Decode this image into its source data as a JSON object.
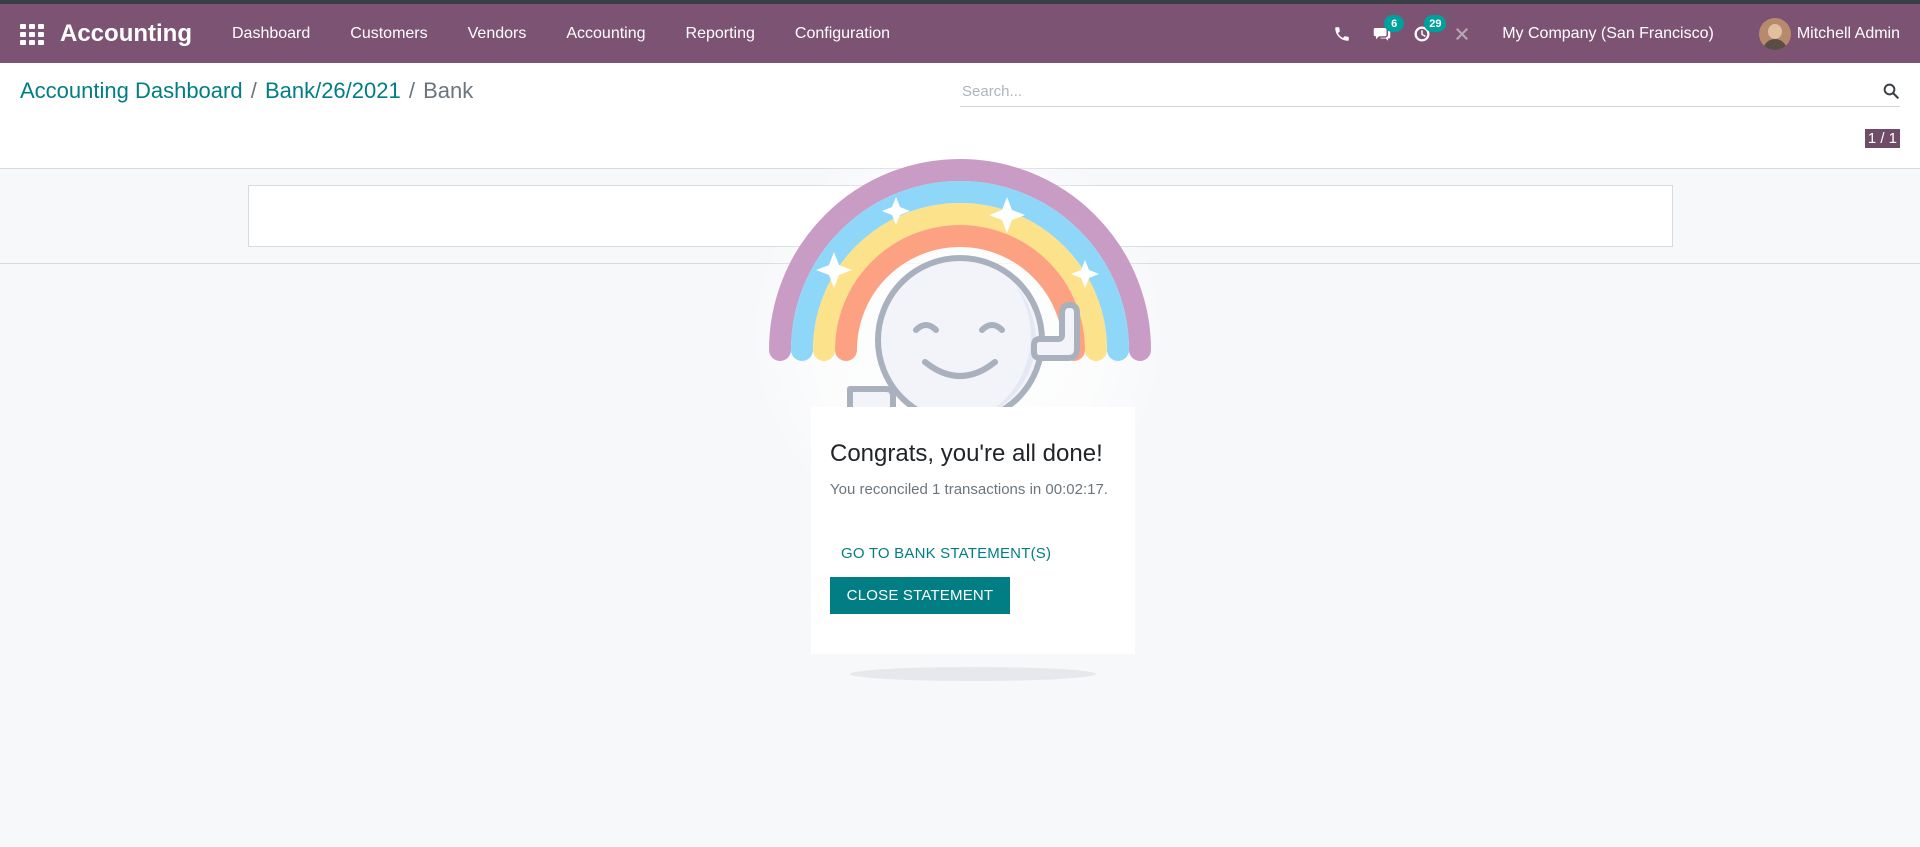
{
  "app": {
    "title": "Accounting",
    "menu": [
      "Dashboard",
      "Customers",
      "Vendors",
      "Accounting",
      "Reporting",
      "Configuration"
    ]
  },
  "systray": {
    "phone_icon": "phone-icon",
    "messages_icon": "chat-icon",
    "messages_count": "6",
    "activities_icon": "clock-icon",
    "activities_count": "29",
    "debug_icon": "wrench-icon",
    "company": "My Company (San Francisco)",
    "user_name": "Mitchell Admin"
  },
  "breadcrumb": {
    "items": [
      "Accounting Dashboard",
      "Bank/26/2021"
    ],
    "current": "Bank"
  },
  "search": {
    "placeholder": "Search...",
    "value": ""
  },
  "pager": "1 / 1",
  "done_card": {
    "title": "Congrats, you're all done!",
    "text": "You reconciled 1 transactions in 00:02:17.",
    "link_label": "GO TO BANK STATEMENT(S)",
    "button_label": "CLOSE STATEMENT"
  },
  "colors": {
    "navbar": "#7c5372",
    "primary": "#017e84",
    "badge": "#00a09d",
    "rainbow": [
      "#c99cc5",
      "#8fd7f8",
      "#fce28a",
      "#fda183"
    ]
  }
}
